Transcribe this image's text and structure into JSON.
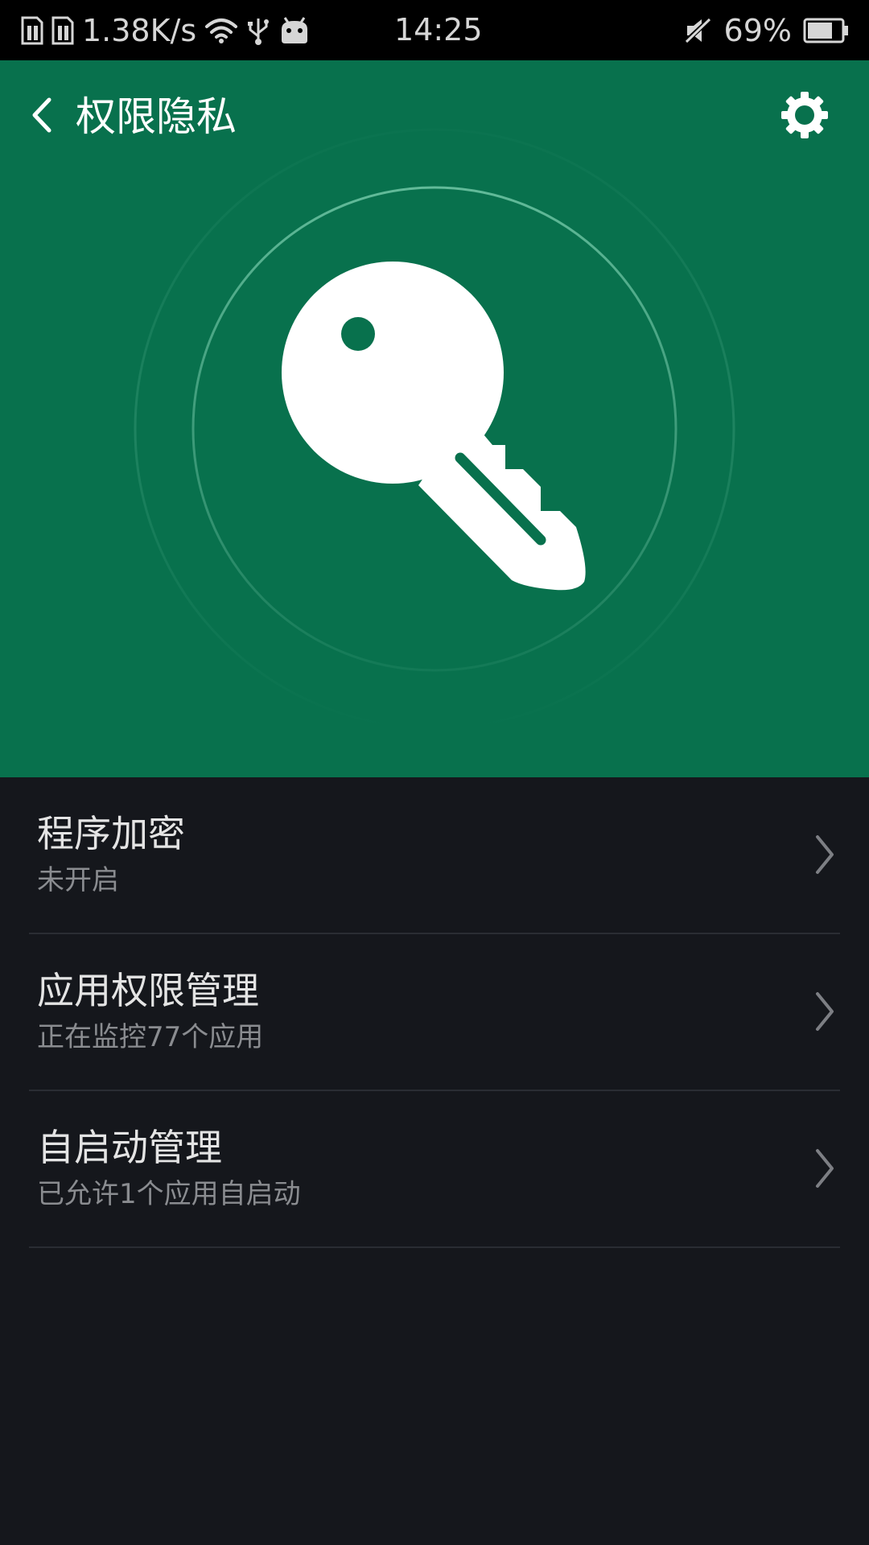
{
  "status_bar": {
    "net_speed": "1.38K/s",
    "time": "14:25",
    "battery": "69%",
    "icons": [
      "sim-1-icon",
      "sim-2-icon",
      "wifi-icon",
      "usb-icon",
      "android-icon",
      "mute-icon",
      "battery-icon"
    ]
  },
  "header": {
    "title": "权限隐私",
    "back_icon": "back-chevron-icon",
    "settings_icon": "gear-icon"
  },
  "hero": {
    "icon": "key-icon",
    "colors": {
      "background": "#08714d",
      "ring": "#4fa888",
      "icon": "#ffffff"
    }
  },
  "list": {
    "items": [
      {
        "title": "程序加密",
        "subtitle": "未开启"
      },
      {
        "title": "应用权限管理",
        "subtitle": "正在监控77个应用"
      },
      {
        "title": "自启动管理",
        "subtitle": "已允许1个应用自启动"
      }
    ]
  },
  "colors": {
    "page_background": "#15171c",
    "title_text": "#e4e4e4",
    "subtitle_text": "#8a8c90",
    "divider": "#2a2d33"
  }
}
